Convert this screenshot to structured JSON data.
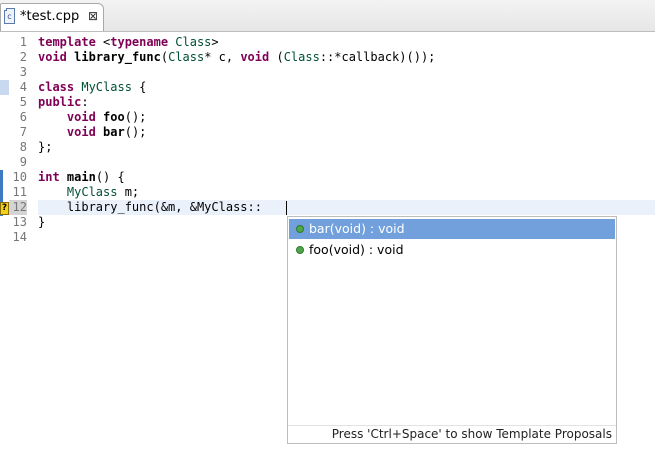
{
  "tab": {
    "title": "*test.cpp",
    "file_icon_glyph": "c",
    "icon": "cpp-file-icon",
    "close_glyph": "⊠"
  },
  "editor": {
    "current_line": 12,
    "line_numbers": [
      "1",
      "2",
      "3",
      "4",
      "5",
      "6",
      "7",
      "8",
      "9",
      "10",
      "11",
      "12",
      "13",
      "14"
    ],
    "warning_marker": "?",
    "lines": [
      [
        {
          "t": "kw",
          "v": "template"
        },
        {
          "t": "pl",
          "v": " <"
        },
        {
          "t": "kw",
          "v": "typename"
        },
        {
          "t": "pl",
          "v": " "
        },
        {
          "t": "ty",
          "v": "Class"
        },
        {
          "t": "pl",
          "v": ">"
        }
      ],
      [
        {
          "t": "kw",
          "v": "void"
        },
        {
          "t": "pl",
          "v": " "
        },
        {
          "t": "fn",
          "v": "library_func"
        },
        {
          "t": "pl",
          "v": "("
        },
        {
          "t": "ty",
          "v": "Class"
        },
        {
          "t": "pl",
          "v": "* c, "
        },
        {
          "t": "kw",
          "v": "void"
        },
        {
          "t": "pl",
          "v": " ("
        },
        {
          "t": "ty",
          "v": "Class"
        },
        {
          "t": "pl",
          "v": "::*callback)());"
        }
      ],
      [],
      [
        {
          "t": "kw",
          "v": "class"
        },
        {
          "t": "pl",
          "v": " "
        },
        {
          "t": "ty",
          "v": "MyClass"
        },
        {
          "t": "pl",
          "v": " {"
        }
      ],
      [
        {
          "t": "kw",
          "v": "public"
        },
        {
          "t": "pl",
          "v": ":"
        }
      ],
      [
        {
          "t": "pl",
          "v": "    "
        },
        {
          "t": "kw",
          "v": "void"
        },
        {
          "t": "pl",
          "v": " "
        },
        {
          "t": "fn",
          "v": "foo"
        },
        {
          "t": "pl",
          "v": "();"
        }
      ],
      [
        {
          "t": "pl",
          "v": "    "
        },
        {
          "t": "kw",
          "v": "void"
        },
        {
          "t": "pl",
          "v": " "
        },
        {
          "t": "fn",
          "v": "bar"
        },
        {
          "t": "pl",
          "v": "();"
        }
      ],
      [
        {
          "t": "pl",
          "v": "};"
        }
      ],
      [],
      [
        {
          "t": "kw",
          "v": "int"
        },
        {
          "t": "pl",
          "v": " "
        },
        {
          "t": "fn",
          "v": "main"
        },
        {
          "t": "pl",
          "v": "() {"
        }
      ],
      [
        {
          "t": "pl",
          "v": "    "
        },
        {
          "t": "ty",
          "v": "MyClass"
        },
        {
          "t": "pl",
          "v": " m;"
        }
      ],
      [
        {
          "t": "pl",
          "v": "    library_func(&m, &MyClass::"
        }
      ],
      [
        {
          "t": "pl",
          "v": "}"
        }
      ],
      []
    ]
  },
  "content_assist": {
    "proposals": [
      {
        "label": "bar(void) : void",
        "icon": "public-method-icon",
        "selected": true
      },
      {
        "label": "foo(void) : void",
        "icon": "public-method-icon",
        "selected": false
      }
    ],
    "hint": "Press 'Ctrl+Space' to show Template Proposals"
  },
  "colors": {
    "keyword": "#7f0055",
    "type": "#005032",
    "selection": "#72a0dc",
    "current_line": "#eaf1fb",
    "method_icon": "#4fa64b"
  }
}
